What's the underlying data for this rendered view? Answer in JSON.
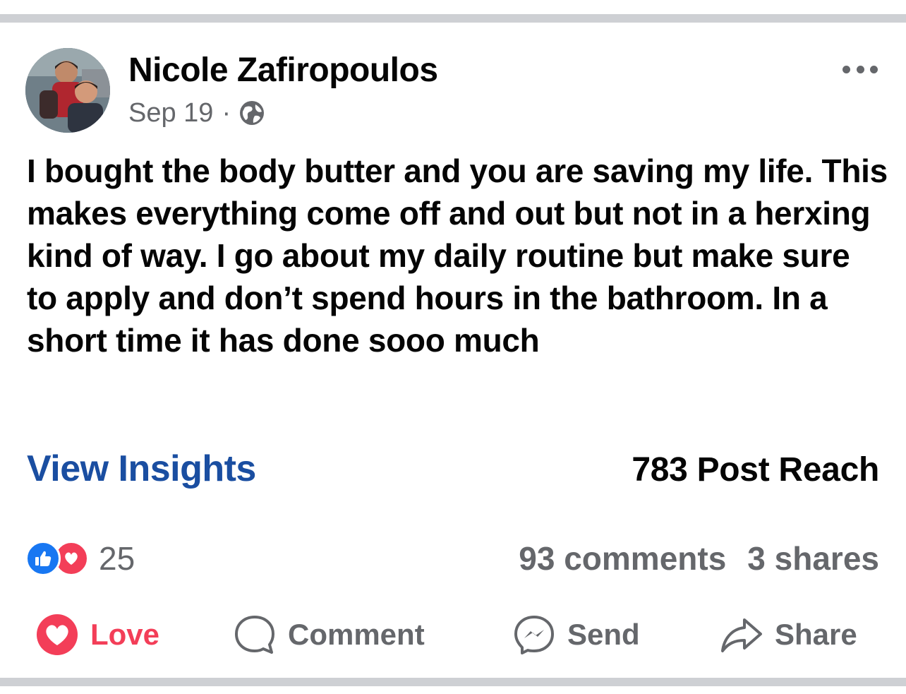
{
  "post": {
    "author_name": "Nicole Zafiropoulos",
    "date": "Sep 19",
    "separator": "·",
    "audience_icon": "globe-icon",
    "more_icon": "more-options-icon",
    "text": "I bought the body butter and you are saving my life. This makes everything come off and out but not in a herxing kind of way. I go about my daily routine but make sure to apply and don’t spend hours in the bathroom. In a short time it has done sooo much"
  },
  "insights": {
    "link_label": "View Insights",
    "reach_label": "783 Post Reach"
  },
  "engagement": {
    "reaction_icons": [
      "like-icon",
      "love-icon"
    ],
    "reaction_count": "25",
    "comments_label": "93 comments",
    "shares_label": "3 shares"
  },
  "actions": {
    "love_label": "Love",
    "comment_label": "Comment",
    "send_label": "Send",
    "share_label": "Share"
  },
  "colors": {
    "link_blue": "#1a4ea1",
    "like_blue": "#1877f2",
    "love_red": "#f33e58",
    "secondary_text": "#65676b",
    "separator_gray": "#ced0d4"
  }
}
